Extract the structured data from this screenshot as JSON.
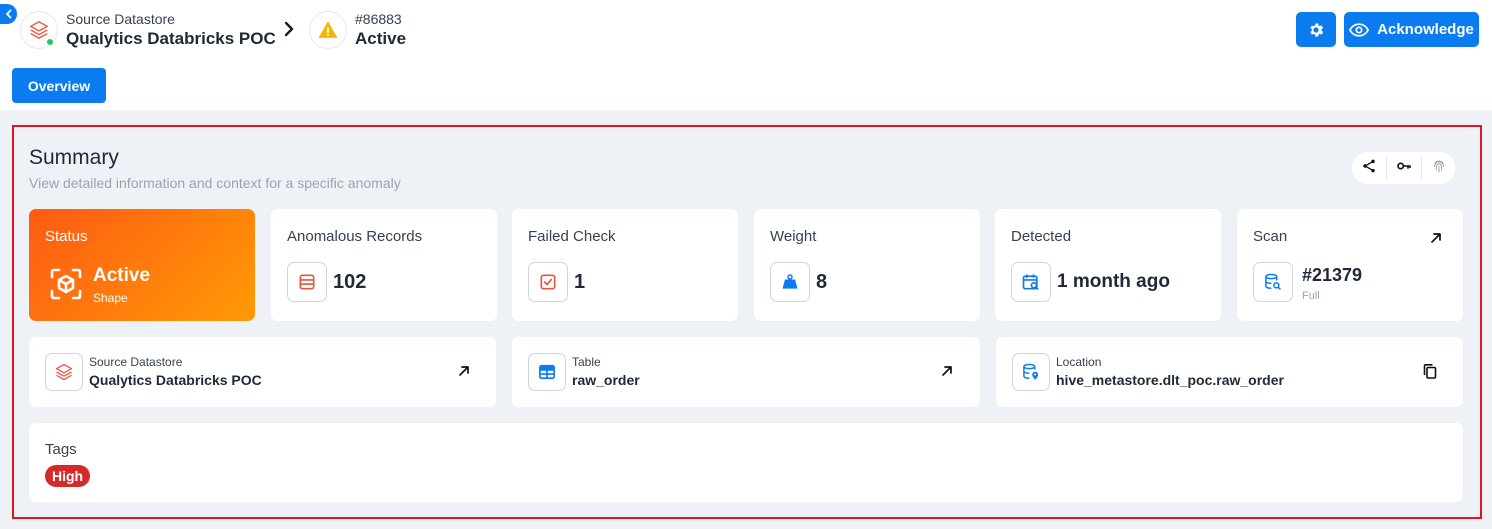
{
  "header": {
    "datastore": {
      "label": "Source Datastore",
      "name": "Qualytics Databricks POC"
    },
    "anomaly": {
      "id": "#86883",
      "status": "Active"
    },
    "acknowledge_label": "Acknowledge",
    "tabs": [
      {
        "label": "Overview"
      }
    ]
  },
  "summary": {
    "title": "Summary",
    "subtitle": "View detailed information and context for a specific anomaly",
    "cards": {
      "status": {
        "label": "Status",
        "value": "Active",
        "sub": "Shape"
      },
      "anomalous_records": {
        "label": "Anomalous Records",
        "value": "102"
      },
      "failed_check": {
        "label": "Failed Check",
        "value": "1"
      },
      "weight": {
        "label": "Weight",
        "value": "8"
      },
      "detected": {
        "label": "Detected",
        "value": "1 month ago"
      },
      "scan": {
        "label": "Scan",
        "value": "#21379",
        "sub": "Full"
      }
    },
    "info": {
      "datastore": {
        "label": "Source Datastore",
        "value": "Qualytics Databricks POC"
      },
      "table": {
        "label": "Table",
        "value": "raw_order"
      },
      "location": {
        "label": "Location",
        "value": "hive_metastore.dlt_poc.raw_order"
      }
    },
    "tags": {
      "label": "Tags",
      "items": [
        "High"
      ]
    }
  },
  "colors": {
    "primary": "#0a7cf0",
    "status_gradient_start": "#ff5a14",
    "status_gradient_end": "#ff9a05",
    "tag_high": "#d42a2a",
    "highlight_border": "#e3131f"
  }
}
